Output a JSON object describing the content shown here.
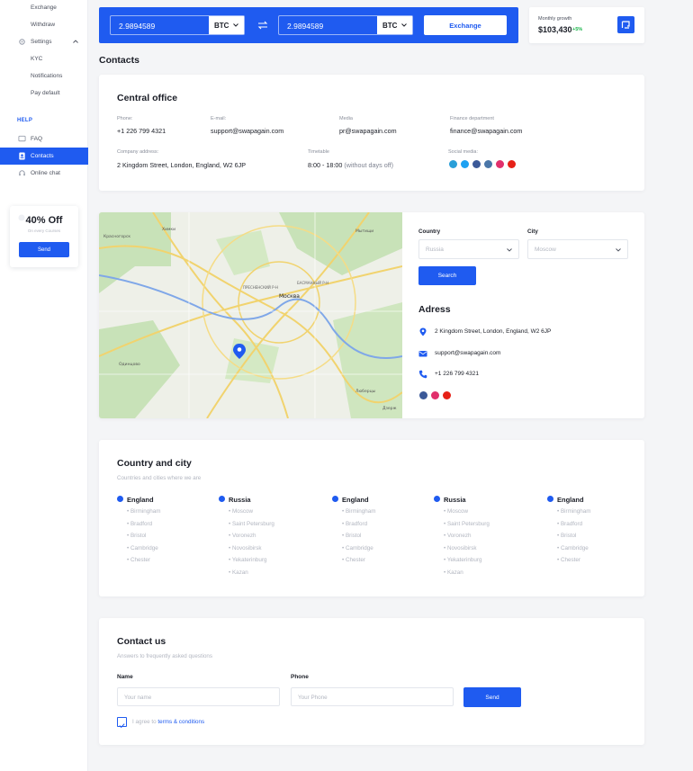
{
  "sidebar": {
    "items": [
      {
        "label": "Exchange"
      },
      {
        "label": "Withdraw"
      },
      {
        "label": "Settings"
      },
      {
        "label": "KYC"
      },
      {
        "label": "Notifications"
      },
      {
        "label": "Pay default"
      }
    ],
    "help_label": "HELP",
    "help_items": [
      {
        "label": "FAQ"
      },
      {
        "label": "Contacts"
      },
      {
        "label": "Online chat"
      }
    ],
    "promo": {
      "title": "40% Off",
      "subtitle": "On every Courses",
      "button": "Send"
    }
  },
  "exchange": {
    "from_amount": "2.9894589",
    "from_currency": "BTC",
    "to_amount": "2.9894589",
    "to_currency": "BTC",
    "button": "Exchange"
  },
  "growth": {
    "label": "Monthly growth",
    "amount": "$103,430",
    "change": "+5%"
  },
  "page_title": "Contacts",
  "office": {
    "title": "Central office",
    "phone_label": "Phone:",
    "phone": "+1 226 799 4321",
    "email_label": "E-mail:",
    "email": "support@swapagain.com",
    "media_label": "Media",
    "media": "pr@swapagain.com",
    "finance_label": "Finance department",
    "finance": "finance@swapagain.com",
    "address_label": "Company address:",
    "address": "2 Kingdom Street, London, England, W2 6JP",
    "timetable_label": "Timetable",
    "timetable": "8:00 - 18:00",
    "timetable_note": "(without days off)",
    "social_label": "Social media:",
    "social": [
      {
        "icon": "telegram-icon",
        "color": "#2a9fd8"
      },
      {
        "icon": "twitter-icon",
        "color": "#1da1f2"
      },
      {
        "icon": "facebook-icon",
        "color": "#3b5998"
      },
      {
        "icon": "vk-icon",
        "color": "#4a76a8"
      },
      {
        "icon": "instagram-icon",
        "color": "#e1306c"
      },
      {
        "icon": "youtube-icon",
        "color": "#e62117"
      }
    ]
  },
  "map": {
    "city_label": "Москва",
    "labels": [
      "Красногорск",
      "Химки",
      "Одинцово",
      "ПРЕСНЕНСКИЙ Р-Н",
      "БАСМАННЫЙ Р-Н",
      "Мытищи",
      "Люберцы",
      "Дзерж"
    ],
    "filters": {
      "country_label": "Country",
      "country_value": "Russia",
      "city_label": "City",
      "city_value": "Moscow",
      "search_button": "Search"
    },
    "adress_title": "Adress",
    "address": "2 Kingdom Street, London, England, W2 6JP",
    "email": "support@swapagain.com",
    "phone": "+1 226 799 4321"
  },
  "countries": {
    "title": "Country and city",
    "subtitle": "Countries and cities where we are",
    "columns": [
      {
        "country": "England",
        "cities": [
          "• Birmingham",
          "• Bradford",
          "• Bristol",
          "• Cambridge",
          "• Chester"
        ]
      },
      {
        "country": "Russia",
        "cities": [
          "• Moscow",
          "• Saint Petersburg",
          "• Voronezh",
          "• Novosibirsk",
          "• Yekaterinburg",
          "• Kazan"
        ]
      },
      {
        "country": "England",
        "cities": [
          "• Birmingham",
          "• Bradford",
          "• Bristol",
          "• Cambridge",
          "• Chester"
        ]
      },
      {
        "country": "Russia",
        "cities": [
          "• Moscow",
          "• Saint Petersburg",
          "• Voronezh",
          "• Novosibirsk",
          "• Yekaterinburg",
          "• Kazan"
        ]
      },
      {
        "country": "England",
        "cities": [
          "• Birmingham",
          "• Bradford",
          "• Bristol",
          "• Cambridge",
          "• Chester"
        ]
      }
    ]
  },
  "contact": {
    "title": "Contact us",
    "subtitle": "Answers to frequently asked questions",
    "name_label": "Name",
    "name_placeholder": "Your name",
    "phone_label": "Phone",
    "phone_placeholder": "Your Phone",
    "send_button": "Send",
    "agree_text": "I agree to",
    "terms_link": "terms & conditions"
  },
  "colors": {
    "accent": "#1f5bf0",
    "positive": "#19b54a"
  }
}
